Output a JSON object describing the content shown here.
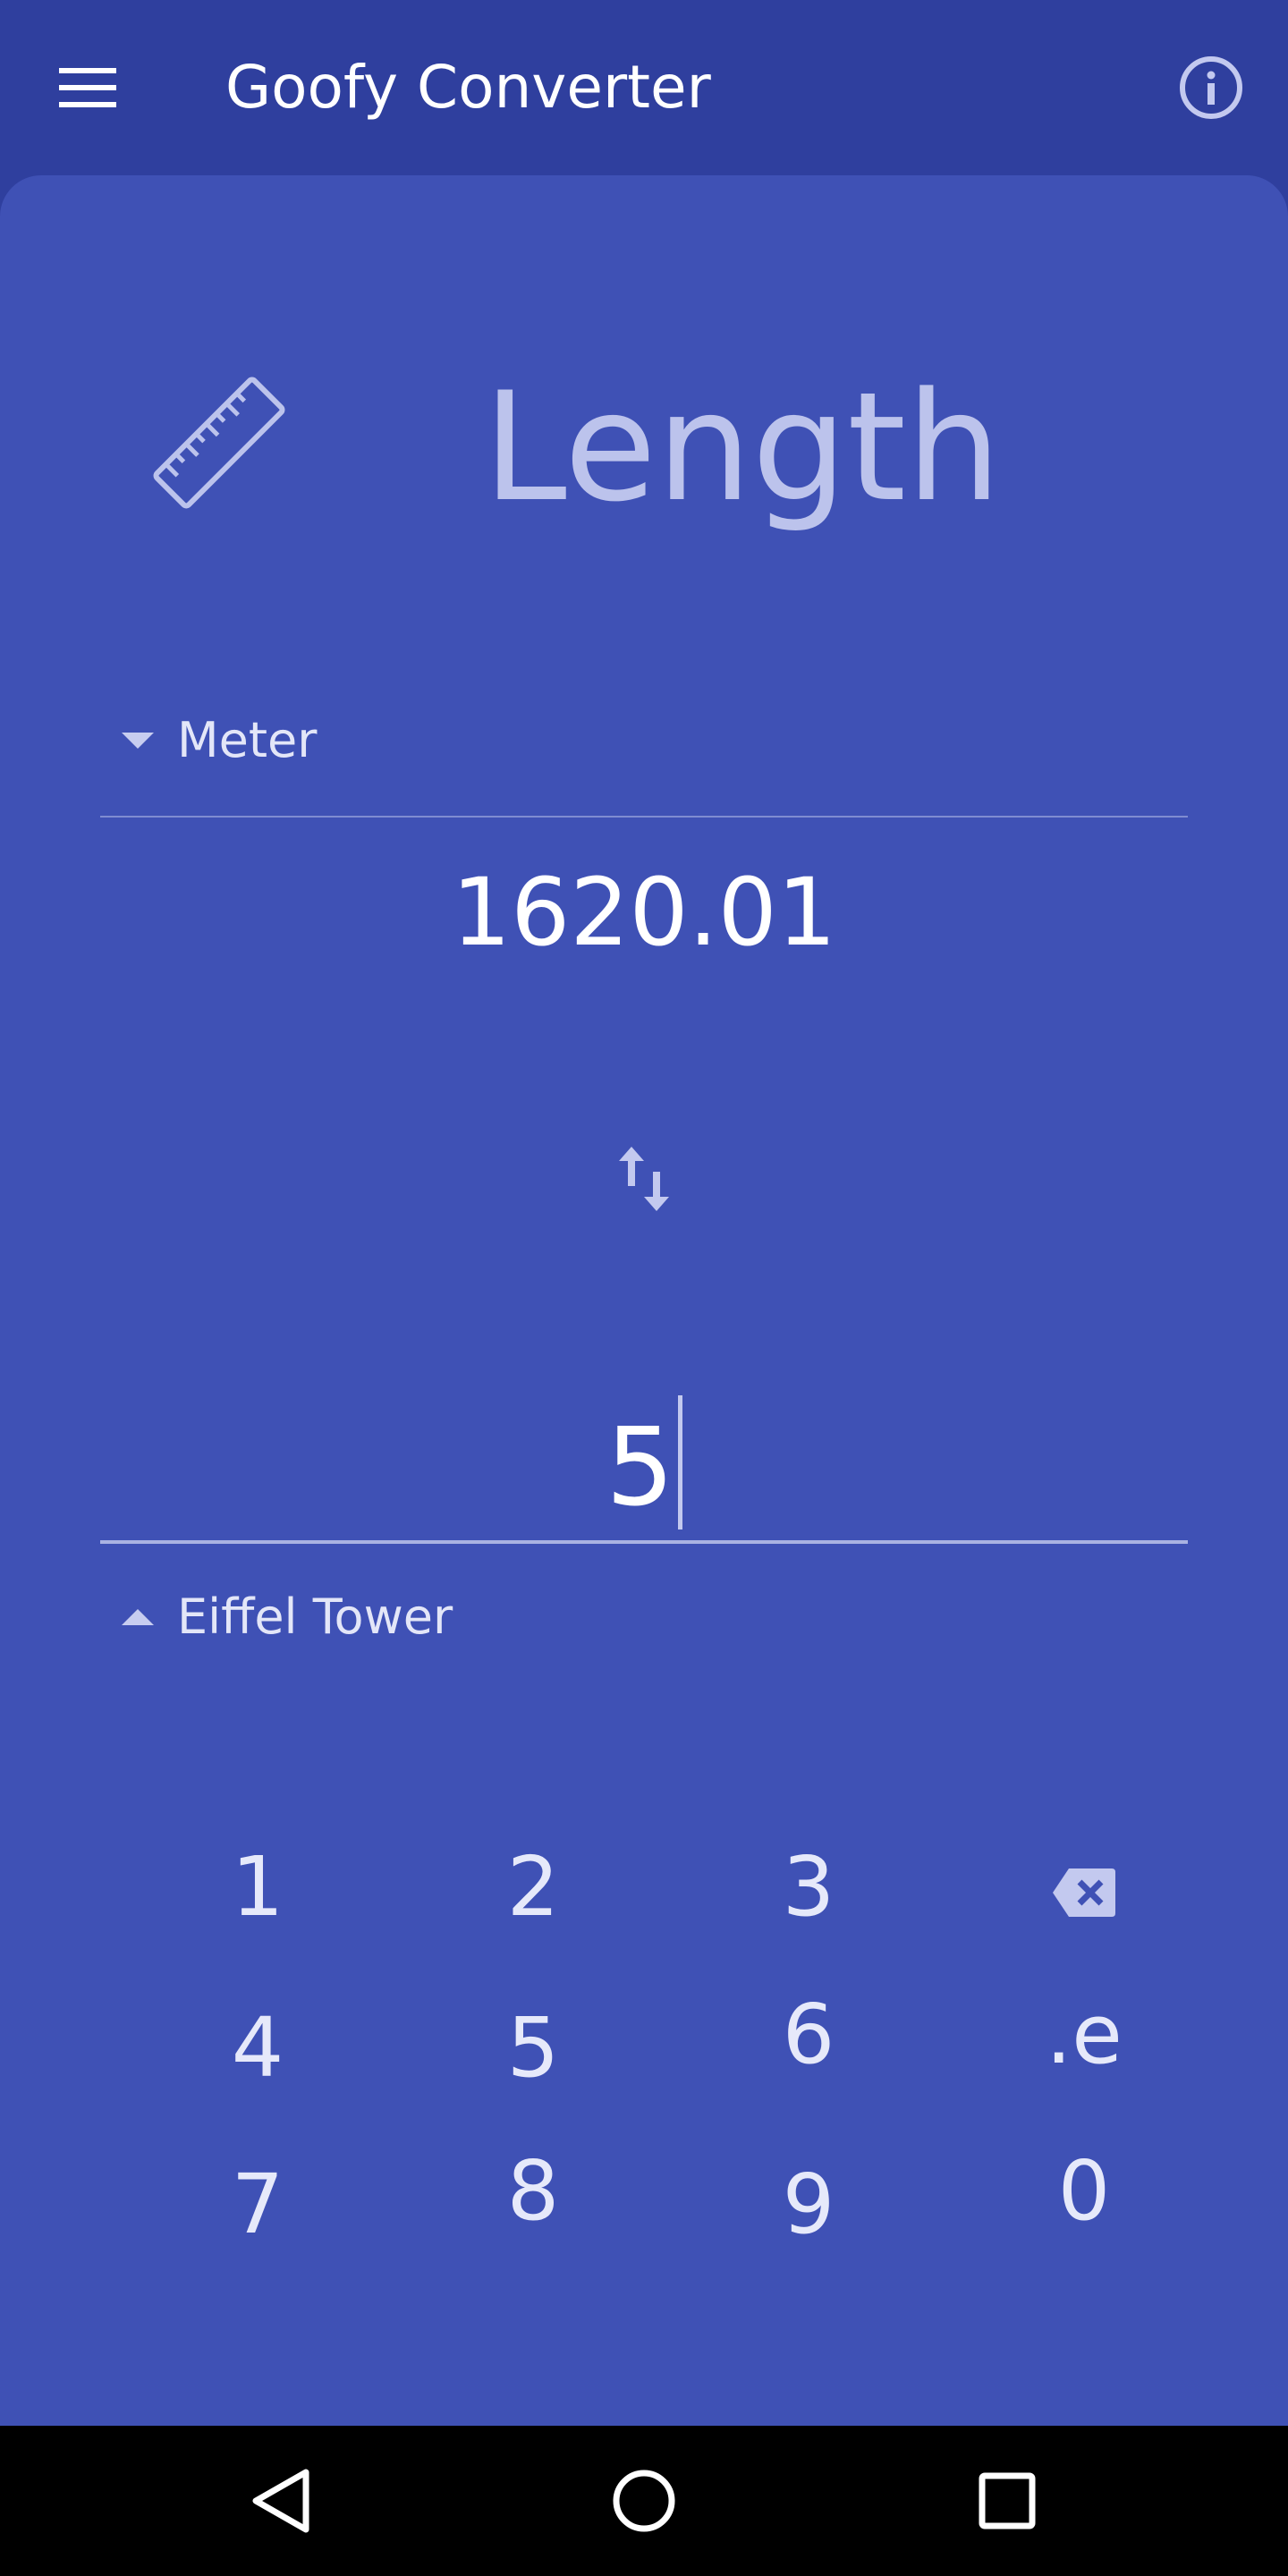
{
  "app_bar": {
    "title": "Goofy Converter",
    "menu_icon": "hamburger-menu-icon",
    "info_icon": "info-icon"
  },
  "converter": {
    "category_icon": "ruler-icon",
    "category": "Length",
    "from_unit": "Meter",
    "from_value": "1620.01",
    "swap_icon": "swap-vertical-icon",
    "to_value": "5",
    "to_unit": "Eiffel Tower"
  },
  "keypad": {
    "keys": [
      "1",
      "2",
      "3",
      "⌫",
      "4",
      "5",
      "6",
      ".e",
      "7",
      "8",
      "9",
      "0"
    ],
    "backspace_icon": "backspace-icon"
  },
  "nav_bar": {
    "back_icon": "back-triangle-icon",
    "home_icon": "home-circle-icon",
    "recents_icon": "recents-square-icon"
  },
  "colors": {
    "app_bar": "#2f3f9e",
    "card": "#3f51b5",
    "accent_text": "#bcc3ec",
    "nav_bar": "#000000"
  }
}
